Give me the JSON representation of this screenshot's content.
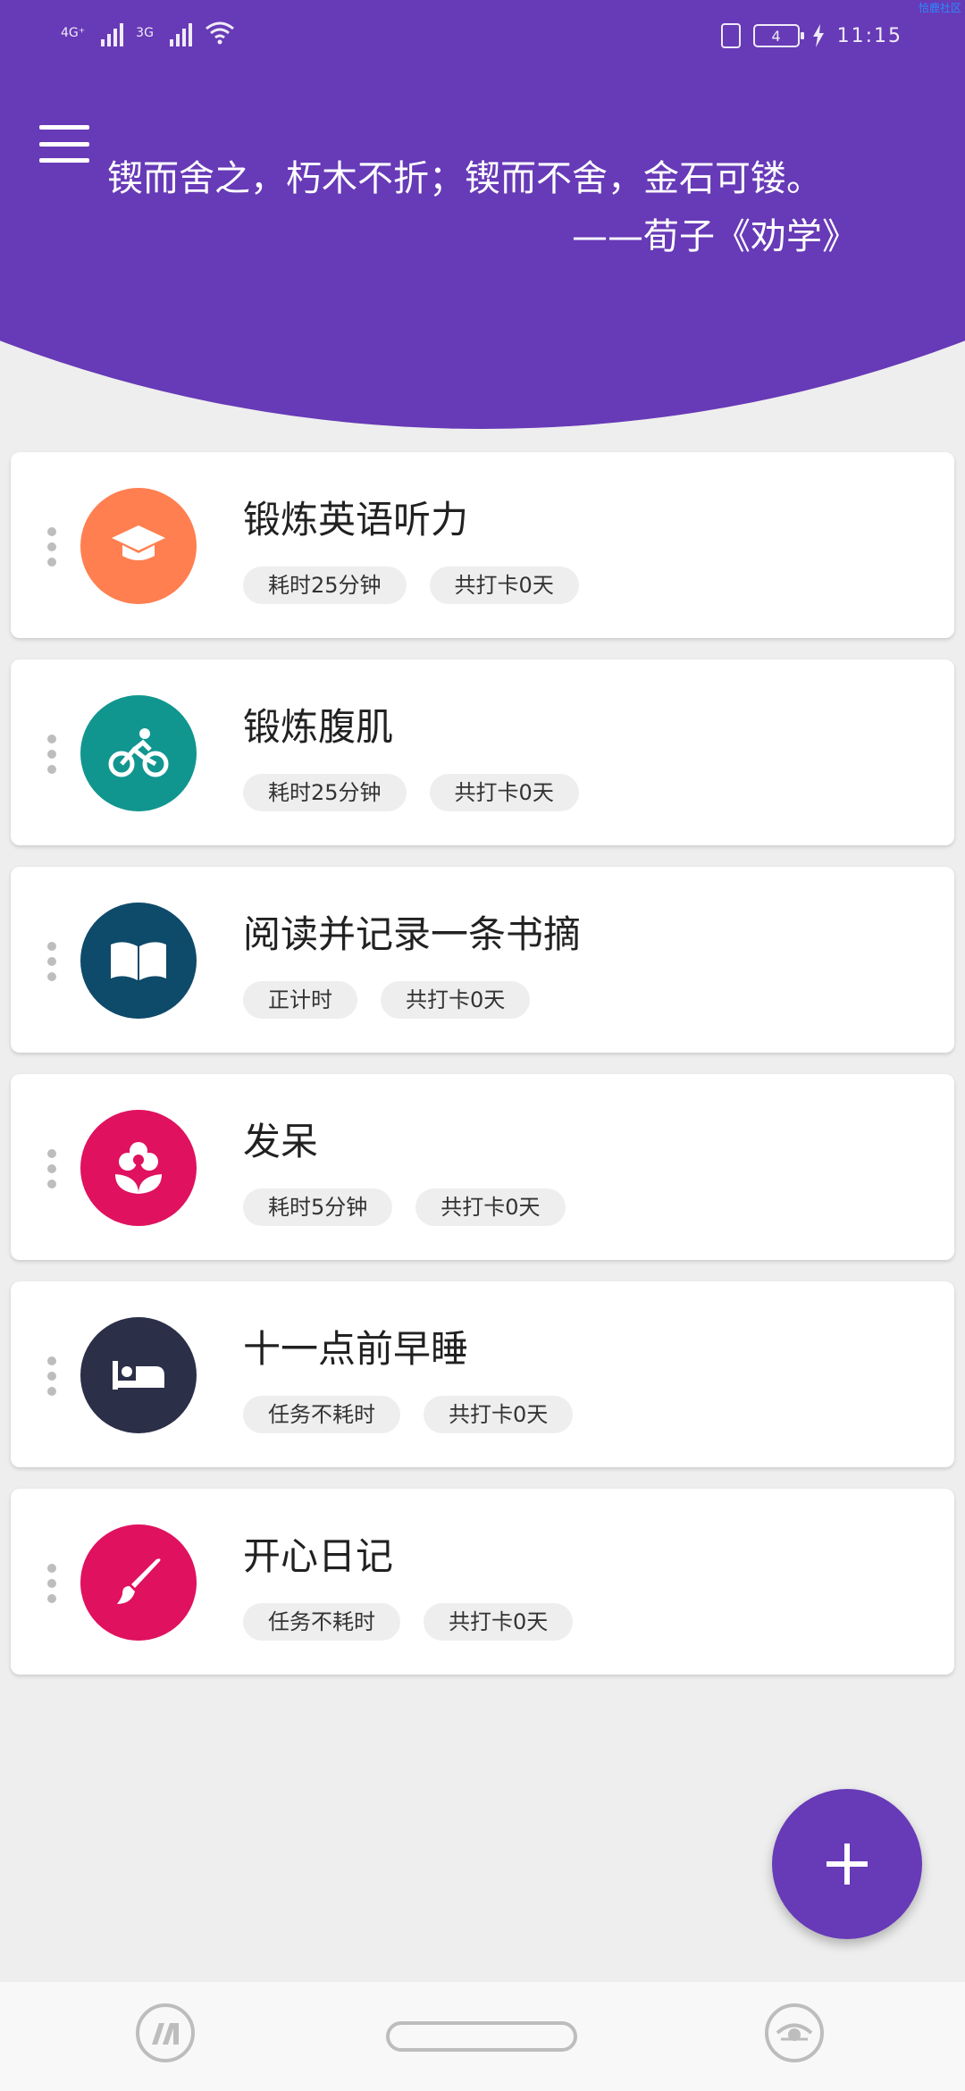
{
  "status_bar": {
    "network_1": "4G⁺",
    "network_2": "3G",
    "battery": "4",
    "time": "11:15",
    "corner_tag": "恰鹿社区"
  },
  "header": {
    "quote": "锲而舍之，朽木不折；锲而不舍，金石可镂。",
    "author": "——荀子《劝学》",
    "color": "#673ab7"
  },
  "tasks": [
    {
      "title": "锻炼英语听力",
      "tag1": "耗时25分钟",
      "tag2": "共打卡0天",
      "icon": "graduation-cap-icon",
      "color": "#ff7f50"
    },
    {
      "title": "锻炼腹肌",
      "tag1": "耗时25分钟",
      "tag2": "共打卡0天",
      "icon": "bicycle-icon",
      "color": "#10968f"
    },
    {
      "title": "阅读并记录一条书摘",
      "tag1": "正计时",
      "tag2": "共打卡0天",
      "icon": "open-book-icon",
      "color": "#0e4a6a"
    },
    {
      "title": "发呆",
      "tag1": "耗时5分钟",
      "tag2": "共打卡0天",
      "icon": "flower-icon",
      "color": "#e0115f"
    },
    {
      "title": "十一点前早睡",
      "tag1": "任务不耗时",
      "tag2": "共打卡0天",
      "icon": "bed-icon",
      "color": "#2b2f48"
    },
    {
      "title": "开心日记",
      "tag1": "任务不耗时",
      "tag2": "共打卡0天",
      "icon": "brush-icon",
      "color": "#e0115f"
    }
  ]
}
